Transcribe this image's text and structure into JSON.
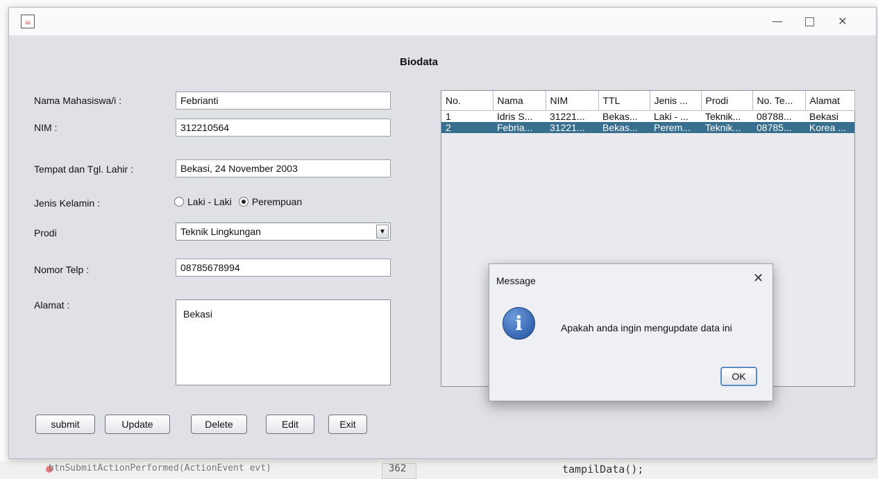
{
  "background": {
    "code_line_number": "362",
    "code_text": "tampilData();",
    "left_text": "btnSubmitActionPerformed(ActionEvent evt)"
  },
  "window": {
    "title_icon": "java-icon",
    "controls": {
      "minimize": "—",
      "close": "✕"
    }
  },
  "form": {
    "title": "Biodata",
    "labels": {
      "nama": "Nama Mahasiswa/i  :",
      "nim": "NIM :",
      "ttl": "Tempat dan Tgl. Lahir :",
      "jenis_kelamin": "Jenis Kelamin :",
      "prodi": "Prodi",
      "telp": "Nomor Telp :",
      "alamat": "Alamat :"
    },
    "values": {
      "nama": "Febrianti",
      "nim": "312210564",
      "ttl": "Bekasi, 24 November 2003",
      "prodi": "Teknik Lingkungan",
      "telp": "08785678994",
      "alamat": "Bekasi"
    },
    "gender_options": [
      {
        "label": "Laki - Laki",
        "checked": false
      },
      {
        "label": "Perempuan",
        "checked": true
      }
    ],
    "buttons": {
      "submit": "submit",
      "update": "Update",
      "delete": "Delete",
      "edit": "Edit",
      "exit": "Exit"
    }
  },
  "table": {
    "columns": [
      "No.",
      "Nama",
      "NIM",
      "TTL",
      "Jenis ...",
      "Prodi",
      "No. Te...",
      "Alamat"
    ],
    "rows": [
      [
        "1",
        "Idris S...",
        "31221...",
        "Bekas...",
        "Laki - ...",
        "Teknik...",
        "08788...",
        "Bekasi"
      ],
      [
        "2",
        "Febria...",
        "31221...",
        "Bekas...",
        "Perem...",
        "Teknik...",
        "08785...",
        "Korea ..."
      ]
    ],
    "selected_row": 2,
    "selection_color": "#396f8e"
  },
  "dialog": {
    "title": "Message",
    "message": "Apakah anda ingin mengupdate data ini",
    "ok_label": "OK",
    "icon": "info-icon",
    "close": "✕"
  }
}
